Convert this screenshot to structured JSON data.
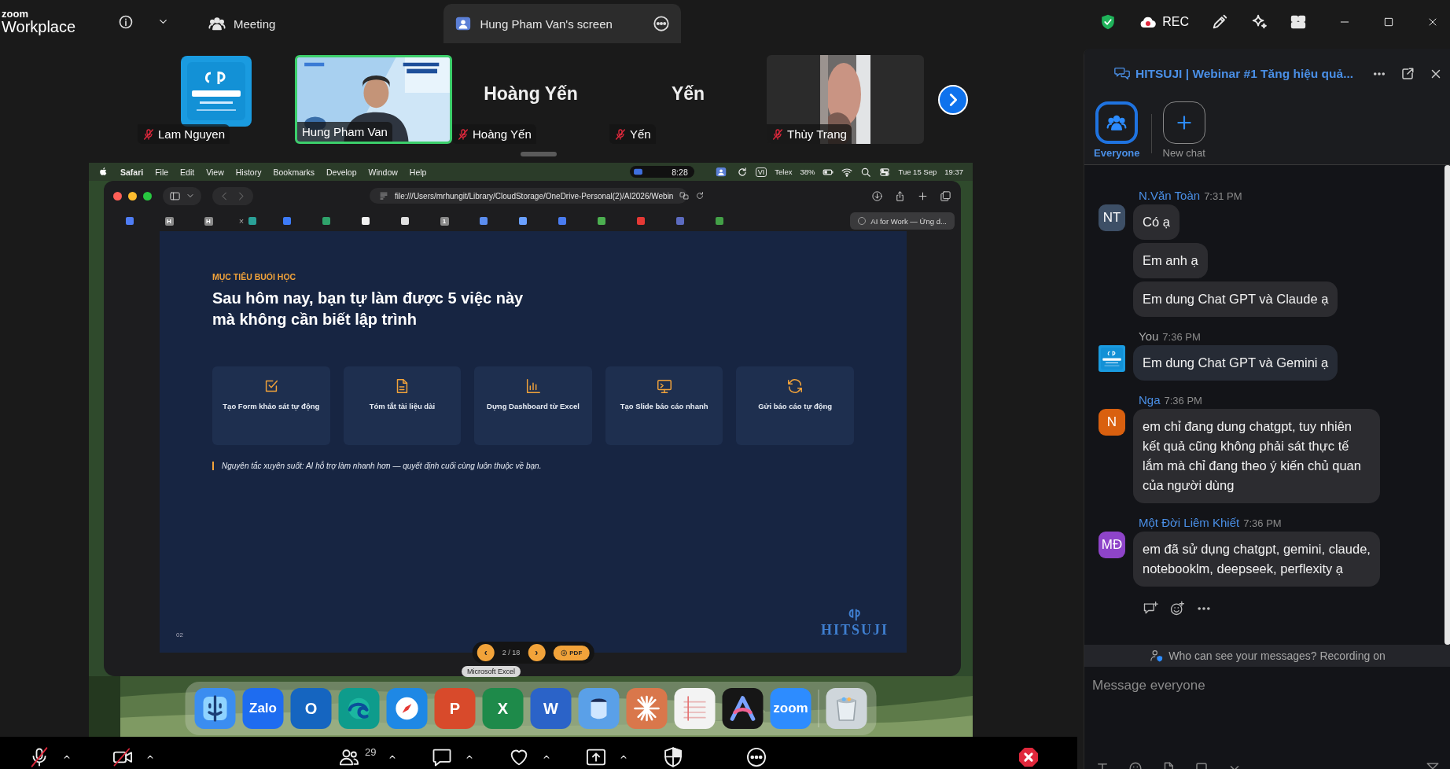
{
  "top_bar": {
    "logo_small": "zoom",
    "logo_large": "Workplace",
    "tabs": [
      {
        "label": "Meeting",
        "kind": "meeting",
        "selected": false
      },
      {
        "label": "Hung Pham Van's screen",
        "kind": "screen",
        "selected": true
      }
    ],
    "record_label": "REC"
  },
  "participants": [
    {
      "name": "Lam Nguyen",
      "kind": "avatar",
      "muted": true,
      "speaking": false
    },
    {
      "name": "Hung Pham Van",
      "kind": "presenter",
      "muted": false,
      "speaking": true
    },
    {
      "name": "Hoàng Yến",
      "kind": "text",
      "display_name": "Hoàng Yến",
      "muted": true,
      "speaking": false
    },
    {
      "name": "Yến",
      "kind": "text",
      "display_name": "Yến",
      "muted": true,
      "speaking": false
    },
    {
      "name": "Thùy Trang",
      "kind": "camera",
      "muted": true,
      "speaking": false
    }
  ],
  "shared_screen": {
    "menu_bar": {
      "app": "Safari",
      "menus": [
        "File",
        "Edit",
        "View",
        "History",
        "Bookmarks",
        "Develop",
        "Window",
        "Help"
      ],
      "timer": "8:28",
      "input_source": "VI",
      "input_method": "Telex",
      "battery": "38%",
      "date": "Tue 15 Sep",
      "time": "19:37"
    },
    "browser": {
      "url": "file:///Users/mrhungit/Library/CloudStorage/OneDrive-Personal(2)/AI2026/Webin",
      "tabs": [
        {
          "kind": "favicon",
          "color": "#4f7df5",
          "selected": false
        },
        {
          "kind": "letter",
          "letter": "H",
          "color": "#8a8a8a",
          "selected": false
        },
        {
          "kind": "letter",
          "letter": "H",
          "color": "#8a8a8a",
          "selected": false
        },
        {
          "kind": "closable",
          "close_mark": "×",
          "color": "#2aa198",
          "selected": false
        },
        {
          "kind": "favicon",
          "color": "#3d7bf7",
          "selected": false
        },
        {
          "kind": "favicon",
          "color": "#2fa36b",
          "selected": false
        },
        {
          "kind": "favicon",
          "color": "#f2f2f2",
          "selected": false
        },
        {
          "kind": "favicon",
          "color": "#e0e0e0",
          "selected": false
        },
        {
          "kind": "letter",
          "letter": "1",
          "color": "#8a8a8a",
          "selected": false
        },
        {
          "kind": "favicon",
          "color": "#5b8def",
          "selected": false
        },
        {
          "kind": "favicon",
          "color": "#6aa0ff",
          "selected": false
        },
        {
          "kind": "favicon",
          "color": "#4a7cf0",
          "selected": false
        },
        {
          "kind": "favicon",
          "color": "#4caf50",
          "selected": false
        },
        {
          "kind": "favicon",
          "color": "#e53935",
          "selected": false
        },
        {
          "kind": "favicon",
          "color": "#5c6bc0",
          "selected": false
        },
        {
          "kind": "favicon",
          "color": "#43a047",
          "selected": false
        },
        {
          "kind": "title",
          "title": "AI for Work — Ứng d...",
          "color": "#9a9a9a",
          "selected": true
        }
      ]
    },
    "slide": {
      "eyebrow": "MỤC TIÊU BUỔI HỌC",
      "heading_lines": [
        "Sau hôm nay, bạn tự làm được 5 việc này",
        "mà không cần biết lập trình"
      ],
      "cards": [
        {
          "kind": "form",
          "label": "Tạo Form khảo sát tự động"
        },
        {
          "kind": "summary",
          "label": "Tóm tắt tài liệu dài"
        },
        {
          "kind": "dashboard",
          "label": "Dựng Dashboard từ Excel"
        },
        {
          "kind": "slides",
          "label": "Tạo Slide báo cáo nhanh"
        },
        {
          "kind": "automation",
          "label": "Gửi báo cáo tự động"
        }
      ],
      "note": "Nguyên tắc xuyên suốt: AI hỗ trợ làm nhanh hơn — quyết định cuối cùng luôn thuộc về bạn.",
      "page_number": "02",
      "brand": "HITSUJI"
    },
    "pager": {
      "prev": "‹",
      "page": "2 / 18",
      "next": "›",
      "pdf": "PDF"
    },
    "tooltip": "Microsoft Excel",
    "dock": [
      {
        "kind": "finder",
        "color": "#3b8df0"
      },
      {
        "kind": "zalo",
        "label": "Zalo",
        "color": "#1e6cf0"
      },
      {
        "kind": "outlook",
        "label": "O",
        "color": "#1565c0"
      },
      {
        "kind": "edge",
        "color": "#0e9c8c"
      },
      {
        "kind": "safari",
        "color": "#1e88e5"
      },
      {
        "kind": "powerpoint",
        "label": "P",
        "color": "#d84a2b"
      },
      {
        "kind": "excel",
        "label": "X",
        "color": "#1e8a4a"
      },
      {
        "kind": "word",
        "label": "W",
        "color": "#2b63c8"
      },
      {
        "kind": "preview",
        "color": "#5aa0e8"
      },
      {
        "kind": "claude",
        "color": "#d9774b"
      },
      {
        "kind": "notes",
        "color": "#f3f3f3"
      },
      {
        "kind": "arc",
        "color": "#161616"
      },
      {
        "kind": "zoom",
        "label": "zoom",
        "color": "#2d8cff"
      },
      {
        "kind": "trash",
        "color": "#cfd6db"
      }
    ]
  },
  "toolbar": {
    "mic_muted": true,
    "video_off": true,
    "participant_count": "29"
  },
  "chat": {
    "title": "HITSUJI | Webinar #1 Tăng hiệu quả...",
    "tabs": [
      {
        "label": "Everyone",
        "kind": "everyone",
        "selected": true
      },
      {
        "label": "New chat",
        "kind": "new",
        "selected": false
      }
    ],
    "groups": [
      {
        "sender": "N.Văn Toàn",
        "time": "7:31 PM",
        "own": false,
        "avatar": {
          "kind": "initials",
          "initials": "NT",
          "color": "#3d4f66"
        },
        "messages": [
          "Có ạ",
          "Em anh ạ",
          "Em dung Chat GPT và Claude ạ"
        ]
      },
      {
        "sender": "You",
        "time": "7:36 PM",
        "own": true,
        "avatar": {
          "kind": "picture"
        },
        "messages": [
          "Em dung Chat GPT và Gemini ạ"
        ]
      },
      {
        "sender": "Nga",
        "time": "7:36 PM",
        "own": false,
        "avatar": {
          "kind": "initials",
          "initials": "N",
          "color": "#d9600f"
        },
        "messages": [
          "em chỉ đang dung chatgpt, tuy nhiên kết quả cũng không phải sát thực tế lắm mà chỉ đang theo ý kiến chủ quan của người dùng"
        ]
      },
      {
        "sender": "Một Đời Liêm Khiết",
        "time": "7:36 PM",
        "own": false,
        "avatar": {
          "kind": "initials",
          "initials": "MĐ",
          "color": "#8e44c9"
        },
        "messages": [
          "em đã sử dụng chatgpt, gemini, claude, notebooklm, deepseek, perflexity ạ"
        ]
      }
    ],
    "notice": "Who can see your messages? Recording on",
    "input_placeholder": "Message everyone"
  }
}
